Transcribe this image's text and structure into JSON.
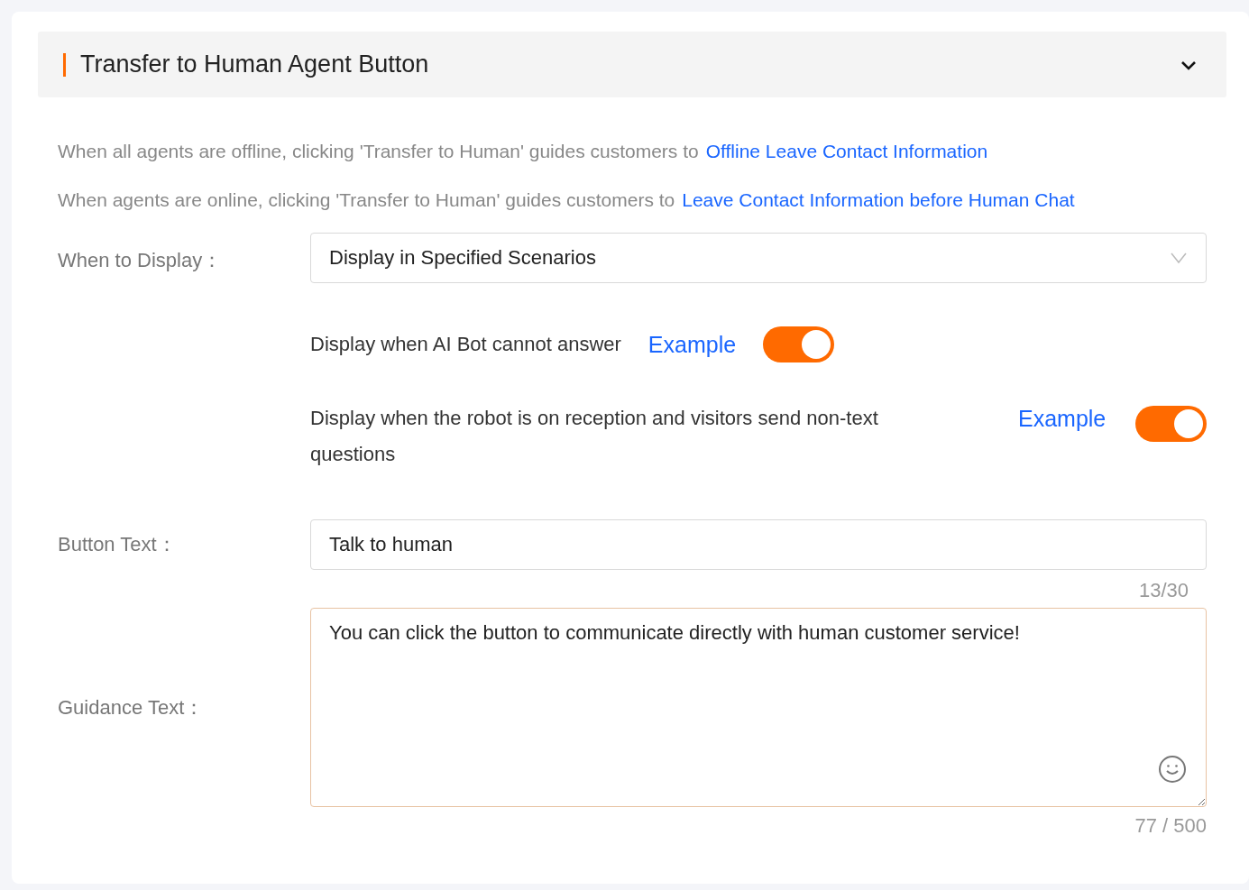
{
  "section": {
    "title": "Transfer to Human Agent Button",
    "expanded": true
  },
  "info_lines": [
    {
      "text": "When all agents are offline, clicking 'Transfer to Human' guides customers to",
      "link": "Offline Leave Contact Information"
    },
    {
      "text": "When agents are online, clicking 'Transfer to Human' guides customers to",
      "link": "Leave Contact Information before Human Chat"
    }
  ],
  "when_to_display": {
    "label": "When to Display：",
    "value": "Display in Specified Scenarios"
  },
  "scenarios": [
    {
      "text": "Display when AI Bot cannot answer",
      "link": "Example",
      "on": true,
      "kind": "inline"
    },
    {
      "text": "Display when the robot is on reception and visitors send non-text questions",
      "link": "Example",
      "on": true,
      "kind": "wide"
    }
  ],
  "button_text": {
    "label": "Button Text：",
    "value": "Talk to human",
    "counter": "13/30"
  },
  "guidance_text": {
    "label": "Guidance Text：",
    "value": "You can click the button to communicate directly with human customer service!",
    "counter": "77 / 500"
  }
}
